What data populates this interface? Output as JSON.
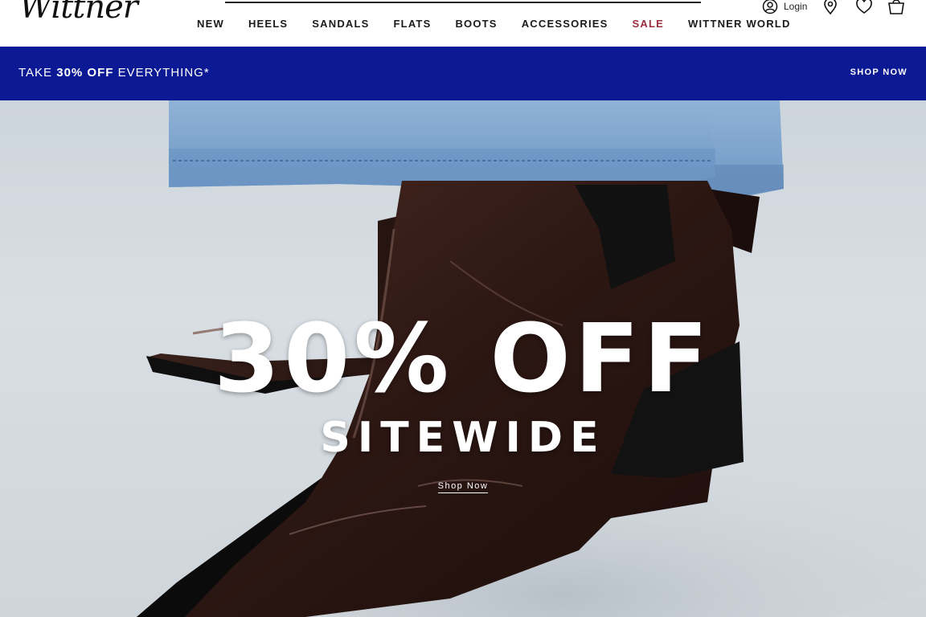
{
  "brand": {
    "logo_text": "Wittner"
  },
  "nav": {
    "items": [
      {
        "label": "NEW"
      },
      {
        "label": "HEELS"
      },
      {
        "label": "SANDALS"
      },
      {
        "label": "FLATS"
      },
      {
        "label": "BOOTS"
      },
      {
        "label": "ACCESSORIES"
      },
      {
        "label": "SALE"
      },
      {
        "label": "WITTNER WORLD"
      }
    ]
  },
  "utility": {
    "login_label": "Login",
    "icons": [
      "user-icon",
      "location-pin-icon",
      "heart-icon",
      "shopping-bag-icon"
    ]
  },
  "promo": {
    "prefix": "TAKE ",
    "highlight": "30% OFF",
    "suffix": " EVERYTHING*",
    "cta": "SHOP NOW",
    "background": "#0b1a94"
  },
  "hero": {
    "title": "30% OFF",
    "subtitle": "SITEWIDE",
    "cta": "Shop Now"
  },
  "colors": {
    "sale": "#9b2d3f",
    "promo_bg": "#0b1a94"
  }
}
